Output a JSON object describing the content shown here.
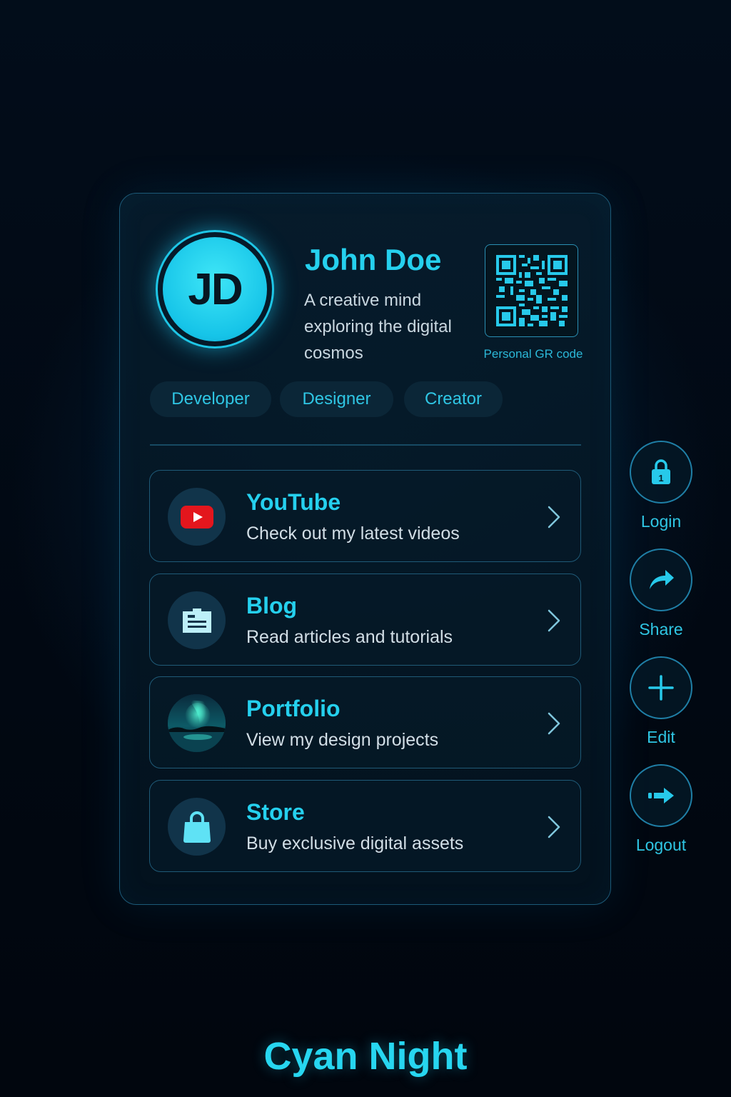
{
  "profile": {
    "initials": "JD",
    "name": "John Doe",
    "bio": "A creative mind exploring the digital cosmos",
    "qr_label": "Personal GR code"
  },
  "tags": [
    "Developer",
    "Designer",
    "Creator"
  ],
  "links": [
    {
      "title": "YouTube",
      "subtitle": "Check out my latest videos",
      "icon": "youtube-icon"
    },
    {
      "title": "Blog",
      "subtitle": "Read articles and tutorials",
      "icon": "blog-icon"
    },
    {
      "title": "Portfolio",
      "subtitle": "View my design projects",
      "icon": "aurora-image"
    },
    {
      "title": "Store",
      "subtitle": "Buy exclusive digital assets",
      "icon": "shopping-bag-icon"
    }
  ],
  "actions": [
    {
      "label": "Login",
      "icon": "lock-icon"
    },
    {
      "label": "Share",
      "icon": "share-arrow-icon"
    },
    {
      "label": "Edit",
      "icon": "plus-icon"
    },
    {
      "label": "Logout",
      "icon": "logout-arrow-icon"
    }
  ],
  "brand": "Cyan Night",
  "colors": {
    "accent": "#25d0ee",
    "background": "#020d1a",
    "border": "#1f5a77"
  }
}
